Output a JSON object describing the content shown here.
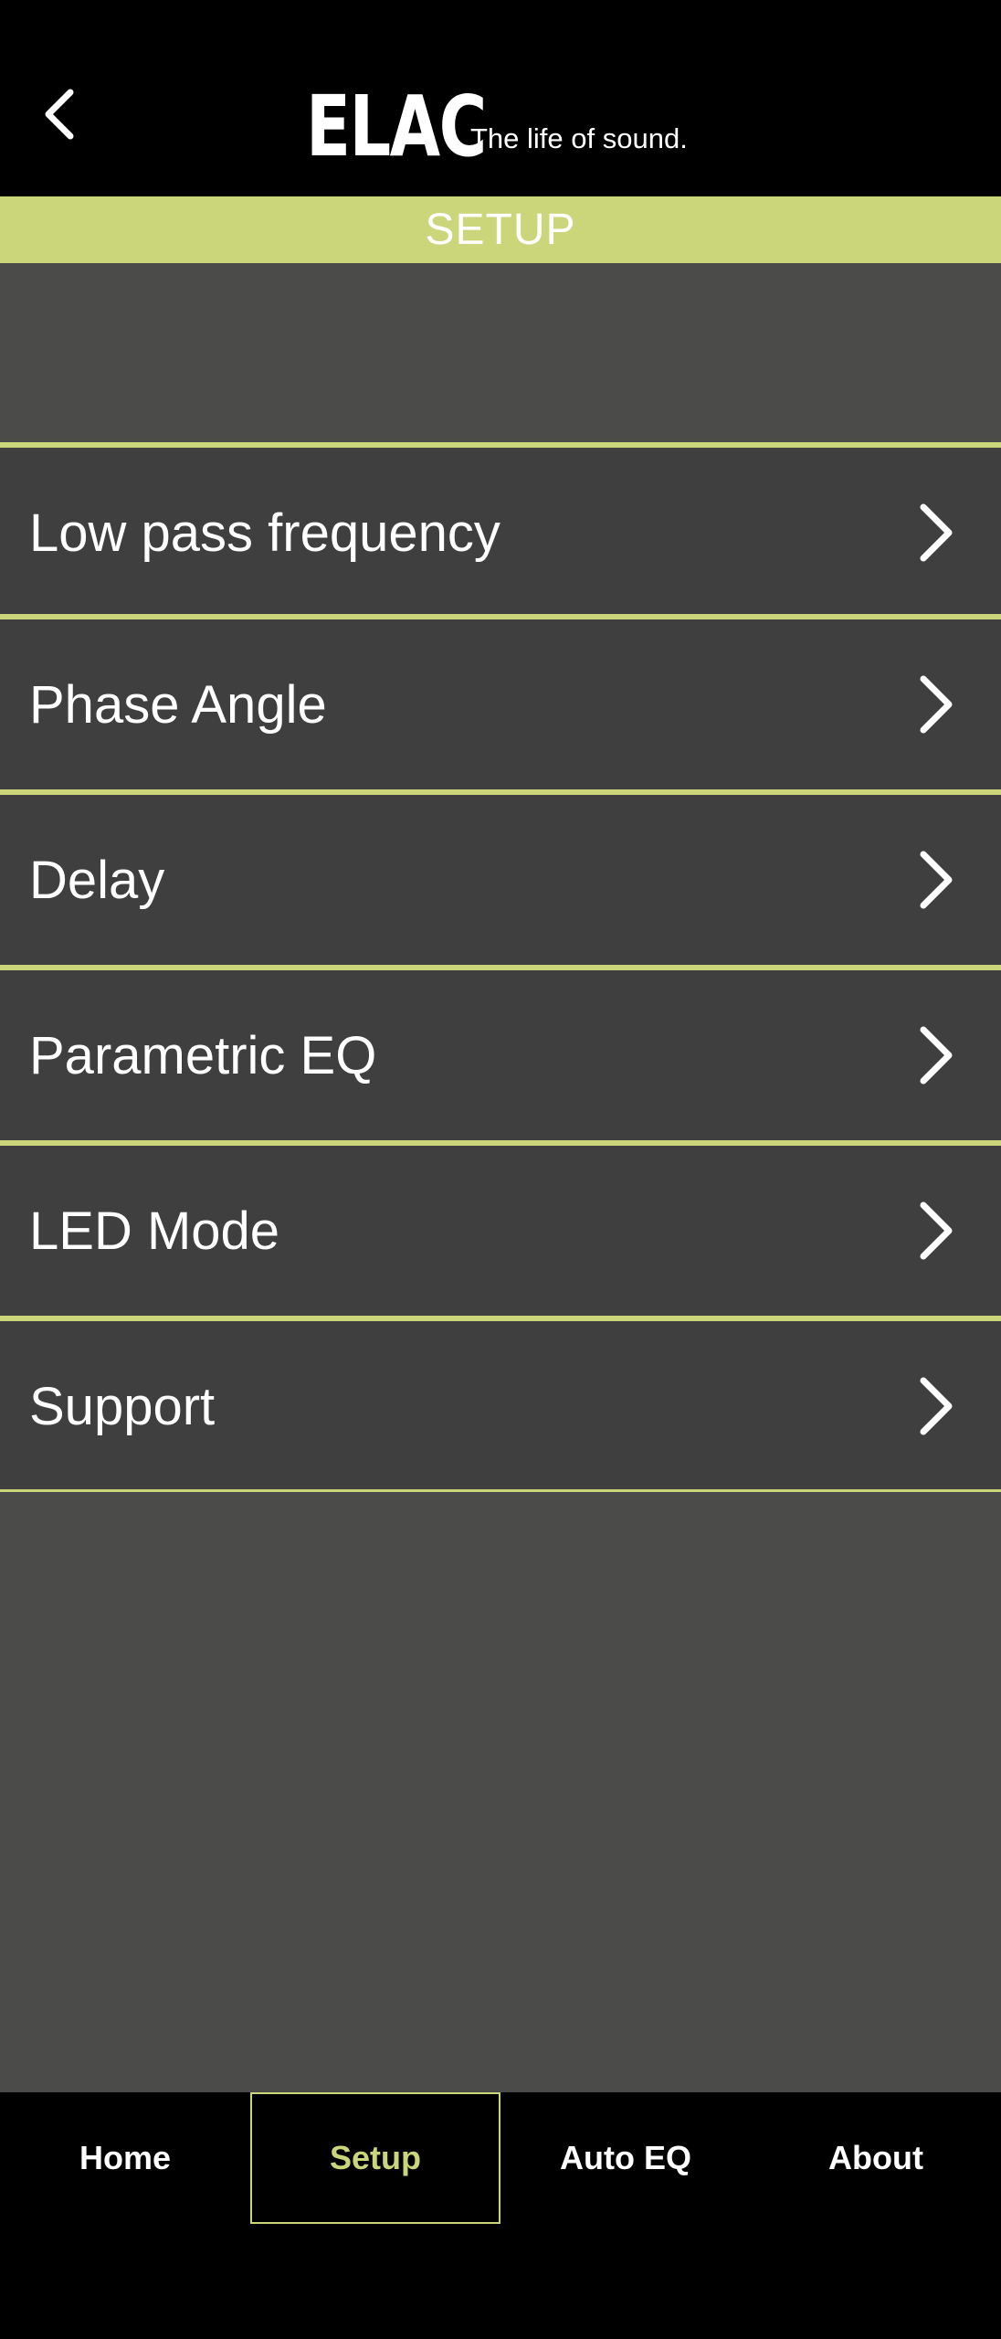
{
  "header": {
    "back_icon": "chevron-left-icon",
    "logo_wordmark": "ELAC",
    "logo_tagline": "The life of sound."
  },
  "section": {
    "title": "SETUP"
  },
  "menu": {
    "items": [
      {
        "label": "Low pass frequency",
        "icon": "chevron-right-icon"
      },
      {
        "label": "Phase Angle",
        "icon": "chevron-right-icon"
      },
      {
        "label": "Delay",
        "icon": "chevron-right-icon"
      },
      {
        "label": "Parametric EQ",
        "icon": "chevron-right-icon"
      },
      {
        "label": "LED Mode",
        "icon": "chevron-right-icon"
      },
      {
        "label": "Support",
        "icon": "chevron-right-icon"
      }
    ]
  },
  "nav": {
    "tabs": [
      {
        "label": "Home",
        "active": false
      },
      {
        "label": "Setup",
        "active": true
      },
      {
        "label": "Auto EQ",
        "active": false
      },
      {
        "label": "About",
        "active": false
      }
    ]
  },
  "colors": {
    "accent": "#cbd57a",
    "background": "#4b4b4a",
    "menu_item_bg": "#3f3f3f",
    "bar_bg": "#000000",
    "text": "#ffffff"
  }
}
